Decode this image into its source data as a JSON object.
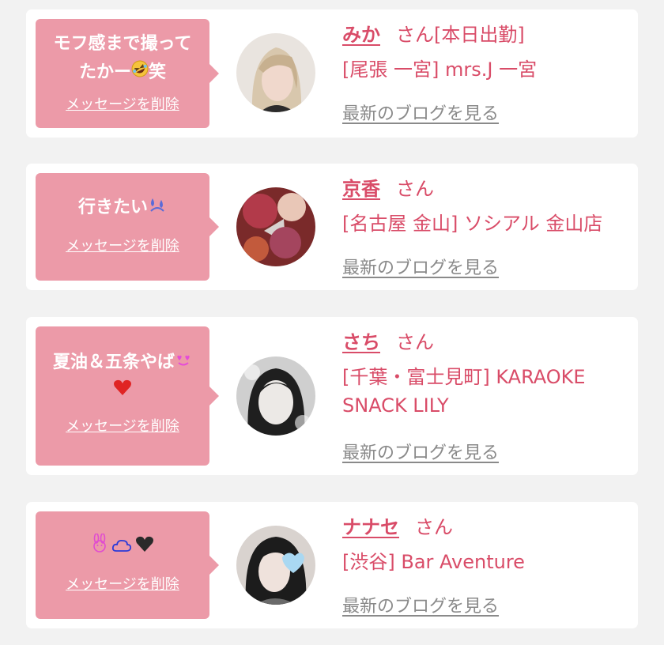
{
  "delete_label": "メッセージを削除",
  "blog_label": "最新のブログを見る",
  "honorific": "さん",
  "entries": [
    {
      "message_lines": [
        "モフ感まで撮って",
        "たかー"
      ],
      "message_emoji": [
        "rolling-on-floor-laughing-emoji"
      ],
      "message_suffix": "笑",
      "name": "みか",
      "status": "[本日出勤]",
      "shop": "[尾張 一宮] mrs.J 一宮"
    },
    {
      "message_lines": [
        "行きたい"
      ],
      "message_emoji": [
        "sweat-droplets-emoji"
      ],
      "message_suffix": "",
      "name": "京香",
      "status": "",
      "shop": "[名古屋 金山] ソシアル 金山店"
    },
    {
      "message_lines": [
        "夏油＆五条やば"
      ],
      "message_emoji": [
        "heart-eyes-emoji",
        "red-heart-emoji"
      ],
      "message_suffix": "",
      "name": "さち",
      "status": "",
      "shop": "[千葉・富士見町] KARAOKE SNACK LILY"
    },
    {
      "message_lines": [
        ""
      ],
      "message_emoji": [
        "rabbit-face-emoji",
        "cloud-emoji",
        "black-heart-emoji"
      ],
      "message_suffix": "",
      "name": "ナナセ",
      "status": "",
      "shop": "[渋谷] Bar Aventure"
    }
  ],
  "colors": {
    "accent": "#d94c68",
    "bubble": "#ec9aa8",
    "link_gray": "#8a8a8a",
    "background": "#f2f2f2"
  }
}
